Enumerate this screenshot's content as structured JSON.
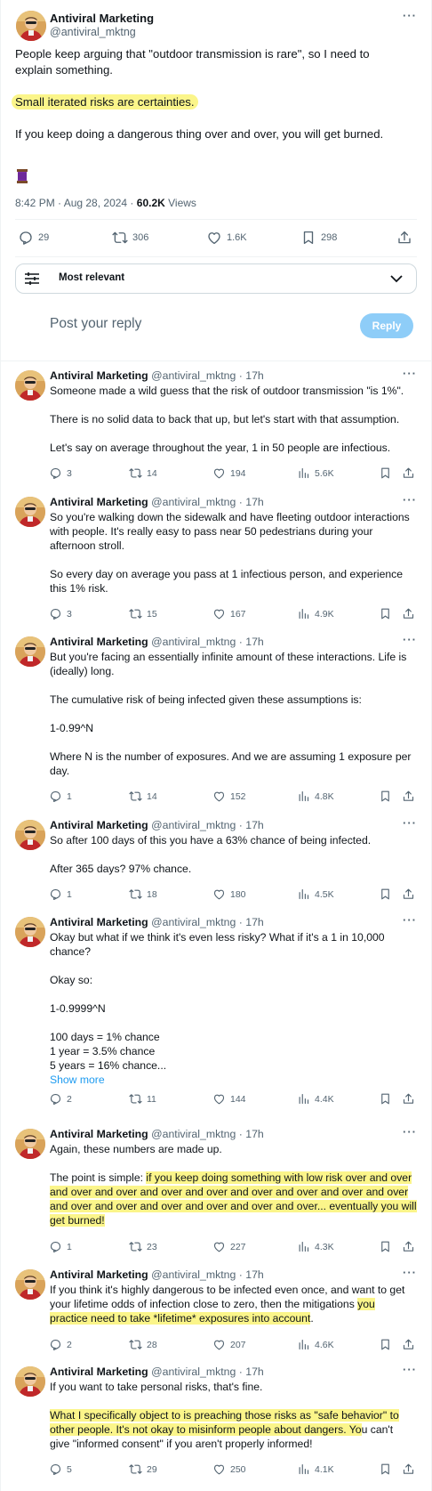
{
  "main_tweet": {
    "author_name": "Antiviral Marketing",
    "author_handle": "@antiviral_mktng",
    "lines": [
      "People keep arguing that \"outdoor transmission is rare\", so I need to",
      "explain something."
    ],
    "highlight": "Small iterated risks are certainties.",
    "line_after": "If you keep doing a dangerous thing over and over, you will get burned.",
    "emoji_icon": "spool-of-thread-icon",
    "timestamp": "8:42 PM · Aug 28, 2024 · ",
    "views_count": "60.2K",
    "views_label": " Views",
    "stats": {
      "replies": "29",
      "reposts": "306",
      "likes": "1.6K",
      "bookmarks": "298"
    }
  },
  "sort": {
    "label": "Most relevant"
  },
  "composer": {
    "placeholder": "Post your reply",
    "button": "Reply"
  },
  "replies": [
    {
      "name": "Antiviral Marketing",
      "meta": "@antiviral_mktng · 17h",
      "paragraphs": [
        "Someone made a wild guess that the risk of outdoor transmission \"is 1%\".",
        "There is no solid data to back that up, but let's start with that assumption.",
        "Let's say on average throughout the year, 1 in 50 people are infectious."
      ],
      "stats": {
        "replies": "3",
        "reposts": "14",
        "likes": "194",
        "views": "5.6K"
      }
    },
    {
      "name": "Antiviral Marketing",
      "meta": "@antiviral_mktng · 17h",
      "paragraphs": [
        "So you're walking down the sidewalk and have fleeting outdoor interactions\nwith people. It's really easy to pass near 50 pedestrians during your\nafternoon stroll.",
        "So every day on average you pass at 1 infectious person, and experience\nthis 1% risk."
      ],
      "stats": {
        "replies": "3",
        "reposts": "15",
        "likes": "167",
        "views": "4.9K"
      }
    },
    {
      "name": "Antiviral Marketing",
      "meta": "@antiviral_mktng · 17h",
      "paragraphs": [
        "But you're facing an essentially infinite amount of these interactions. Life is\n(ideally) long.",
        "The cumulative risk of being infected given these assumptions is:",
        "1-0.99^N",
        "Where N is the number of exposures. And we are assuming 1 exposure per\nday."
      ],
      "stats": {
        "replies": "1",
        "reposts": "14",
        "likes": "152",
        "views": "4.8K"
      }
    },
    {
      "name": "Antiviral Marketing",
      "meta": "@antiviral_mktng · 17h",
      "paragraphs": [
        "So after 100 days of this you have a 63% chance of being infected.",
        "After 365 days? 97% chance."
      ],
      "stats": {
        "replies": "1",
        "reposts": "18",
        "likes": "180",
        "views": "4.5K"
      }
    },
    {
      "name": "Antiviral Marketing",
      "meta": "@antiviral_mktng · 17h",
      "paragraphs": [
        "Okay but what if we think it's even less risky? What if it's a 1 in 10,000\nchance?",
        "Okay so:",
        "1-0.9999^N",
        "100 days = 1% chance\n1 year = 3.5% chance\n5 years = 16% chance..."
      ],
      "show_more": "Show more",
      "stats": {
        "replies": "2",
        "reposts": "11",
        "likes": "144",
        "views": "4.4K"
      }
    },
    {
      "name": "Antiviral Marketing",
      "meta": "@antiviral_mktng · 17h",
      "p1": "Again, these numbers are made up.",
      "p2_prefix": "The point is simple: ",
      "p2_highlight": "if you keep doing something with low risk over and over\nand over and over and over and over and over and over and over and over\nand over and over and over and over and over and over... eventually you will\nget burned!",
      "stats": {
        "replies": "1",
        "reposts": "23",
        "likes": "227",
        "views": "4.3K"
      }
    },
    {
      "name": "Antiviral Marketing",
      "meta": "@antiviral_mktng · 17h",
      "p1_prefix": "If you think it's highly dangerous to be infected even once, and want to get\nyour lifetime odds of infection close to zero, then the mitigations ",
      "p1_highlight": "you\npractice need to take *lifetime* exposures into account",
      "p1_suffix": ".",
      "stats": {
        "replies": "2",
        "reposts": "28",
        "likes": "207",
        "views": "4.6K"
      }
    },
    {
      "name": "Antiviral Marketing",
      "meta": "@antiviral_mktng · 17h",
      "p1": "If you want to take personal risks, that's fine.",
      "p2_highlight": "What I specifically object to is preaching those risks as \"safe behavior\" to\nother people. It's not okay to misinform people about dangers. Yo",
      "p2_suffix": "u can't\ngive \"informed consent\" if you aren't properly informed!",
      "stats": {
        "replies": "5",
        "reposts": "29",
        "likes": "250",
        "views": "4.1K"
      }
    }
  ]
}
